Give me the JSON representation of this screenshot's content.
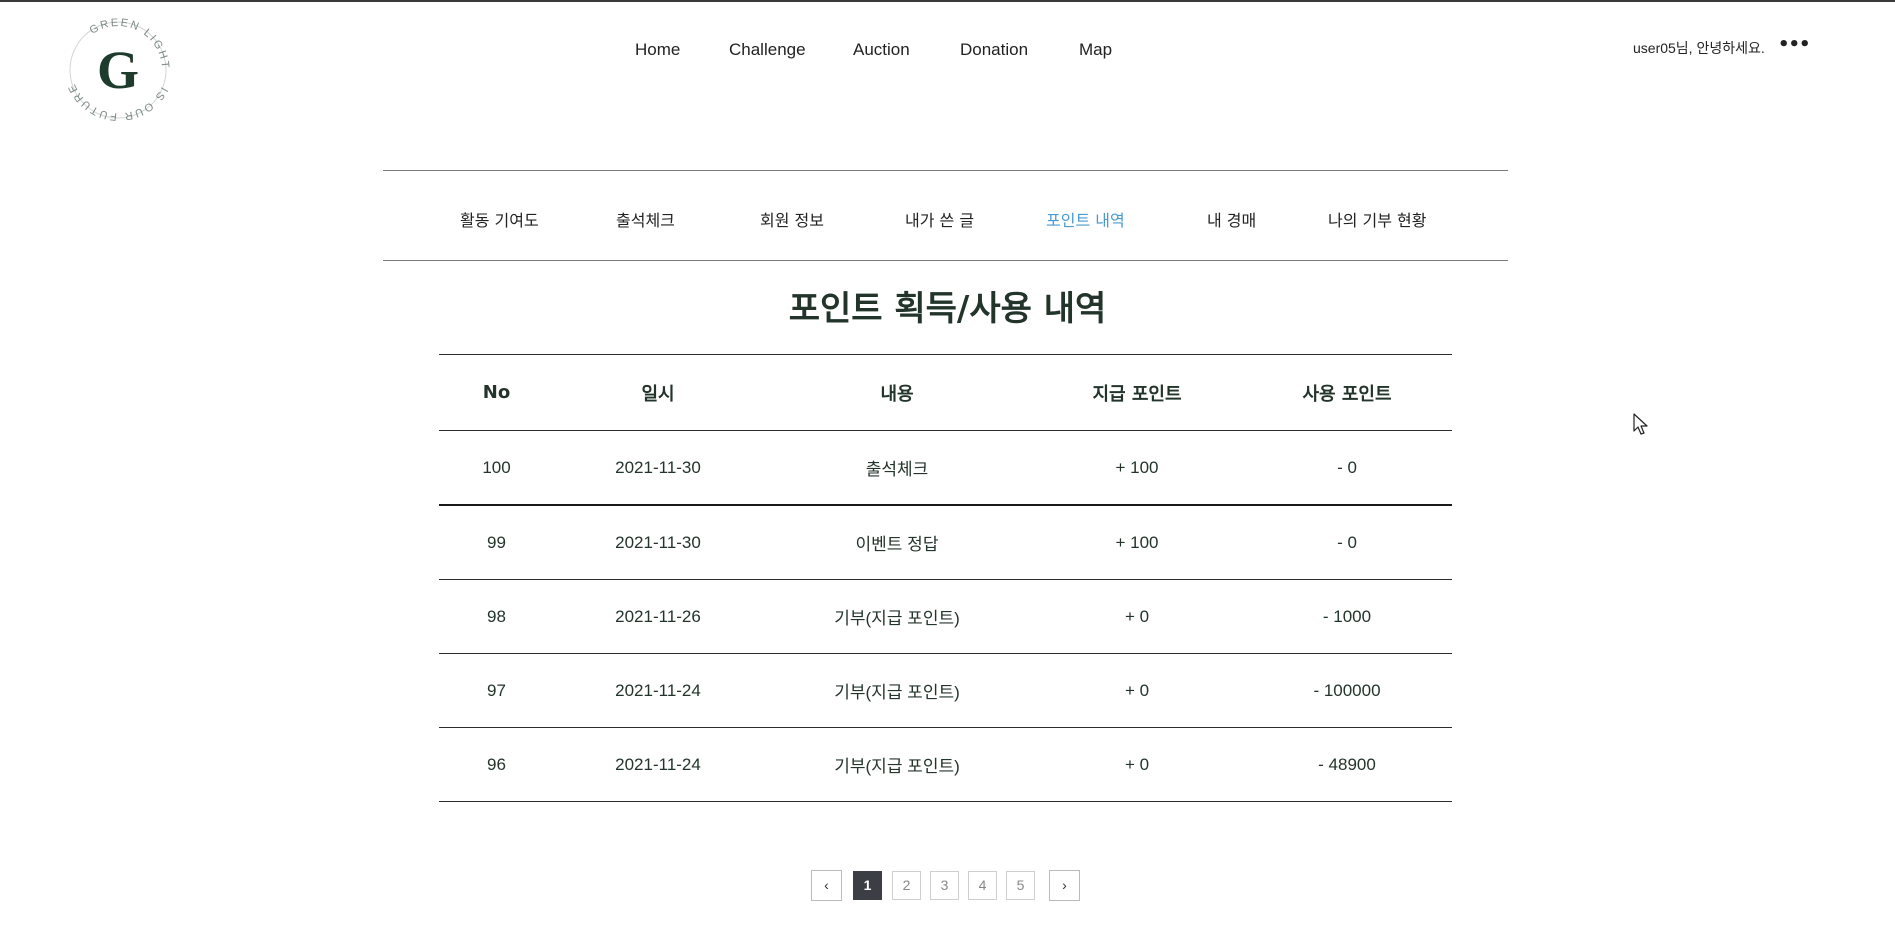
{
  "header": {
    "logo": {
      "ring_text_top": "GREEN LIGHT",
      "ring_text_bottom": "IS OUR FUTURE",
      "letter": "G"
    },
    "nav": [
      "Home",
      "Challenge",
      "Auction",
      "Donation",
      "Map"
    ],
    "greeting": "user05님, 안녕하세요.",
    "more_icon": "•••"
  },
  "mypage_tabs": {
    "items": [
      "활동 기여도",
      "출석체크",
      "회원 정보",
      "내가 쓴 글",
      "포인트 내역",
      "내 경매",
      "나의 기부 현황"
    ],
    "active_index": 4,
    "active_color": "#4a9bd1"
  },
  "page_title": "포인트 획득/사용 내역",
  "points_table": {
    "columns": [
      "No",
      "일시",
      "내용",
      "지급 포인트",
      "사용 포인트"
    ],
    "rows": [
      [
        "100",
        "2021-11-30",
        "출석체크",
        "+ 100",
        "- 0"
      ],
      [
        "99",
        "2021-11-30",
        "이벤트 정답",
        "+ 100",
        "- 0"
      ],
      [
        "98",
        "2021-11-26",
        "기부(지급 포인트)",
        "+ 0",
        "- 1000"
      ],
      [
        "97",
        "2021-11-24",
        "기부(지급 포인트)",
        "+ 0",
        "- 100000"
      ],
      [
        "96",
        "2021-11-24",
        "기부(지급 포인트)",
        "+ 0",
        "- 48900"
      ]
    ]
  },
  "pagination": {
    "prev_icon": "‹",
    "next_icon": "›",
    "pages": [
      "1",
      "2",
      "3",
      "4",
      "5"
    ],
    "current": "1"
  }
}
